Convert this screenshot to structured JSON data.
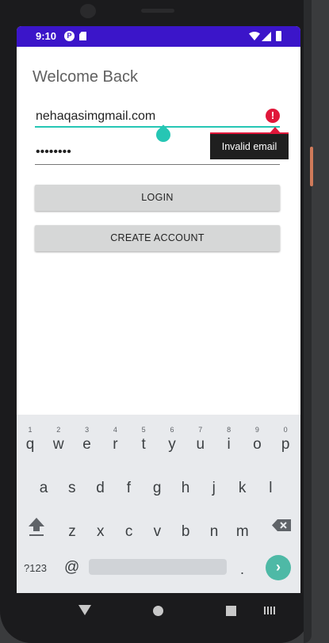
{
  "status_bar": {
    "time": "9:10",
    "app_icon_letter": "P"
  },
  "screen": {
    "title": "Welcome Back",
    "email": {
      "value": "nehaqasimgmail.com",
      "error_icon": "!",
      "error_message": "Invalid email"
    },
    "password": {
      "value": "••••••••"
    },
    "buttons": {
      "login": "LOGIN",
      "create_account": "CREATE ACCOUNT"
    }
  },
  "keyboard": {
    "row1": [
      {
        "key": "q",
        "hint": "1"
      },
      {
        "key": "w",
        "hint": "2"
      },
      {
        "key": "e",
        "hint": "3"
      },
      {
        "key": "r",
        "hint": "4"
      },
      {
        "key": "t",
        "hint": "5"
      },
      {
        "key": "y",
        "hint": "6"
      },
      {
        "key": "u",
        "hint": "7"
      },
      {
        "key": "i",
        "hint": "8"
      },
      {
        "key": "o",
        "hint": "9"
      },
      {
        "key": "p",
        "hint": "0"
      }
    ],
    "row2": [
      "a",
      "s",
      "d",
      "f",
      "g",
      "h",
      "j",
      "k",
      "l"
    ],
    "row3": [
      "z",
      "x",
      "c",
      "v",
      "b",
      "n",
      "m"
    ],
    "symbols_key": "?123",
    "at_key": "@",
    "period_key": ".",
    "enter_glyph": "›"
  },
  "colors": {
    "status_bar": "#3b15c9",
    "accent": "#26c6b4",
    "error": "#e0173a",
    "enter_key": "#4eb9a6"
  }
}
